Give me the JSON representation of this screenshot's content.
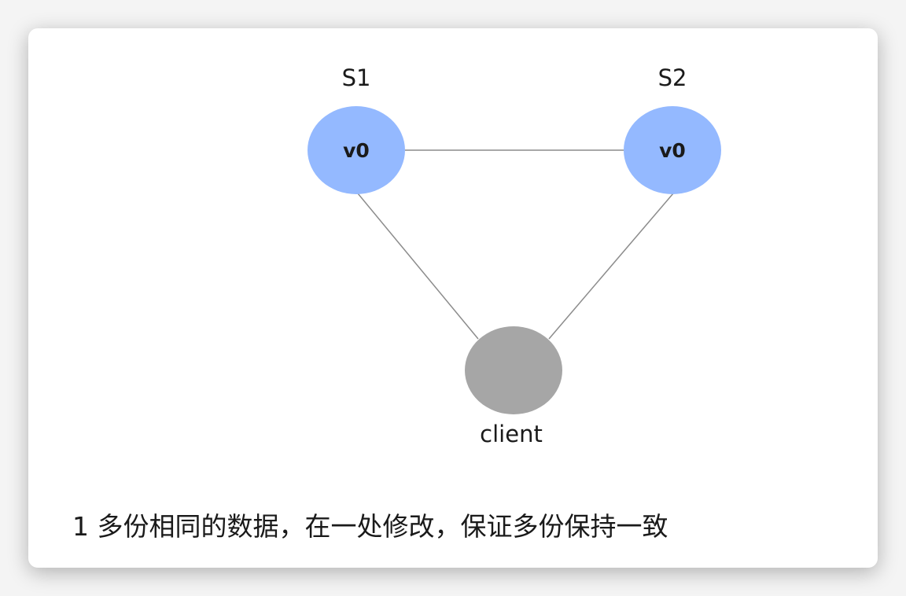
{
  "colors": {
    "server_fill": "#94b9ff",
    "client_fill": "#a6a6a6",
    "edge": "#8c8c8c"
  },
  "nodes": {
    "s1": {
      "label": "S1",
      "value": "v0"
    },
    "s2": {
      "label": "S2",
      "value": "v0"
    },
    "client": {
      "label": "client"
    }
  },
  "caption": "1 多份相同的数据，在一处修改，保证多份保持一致"
}
